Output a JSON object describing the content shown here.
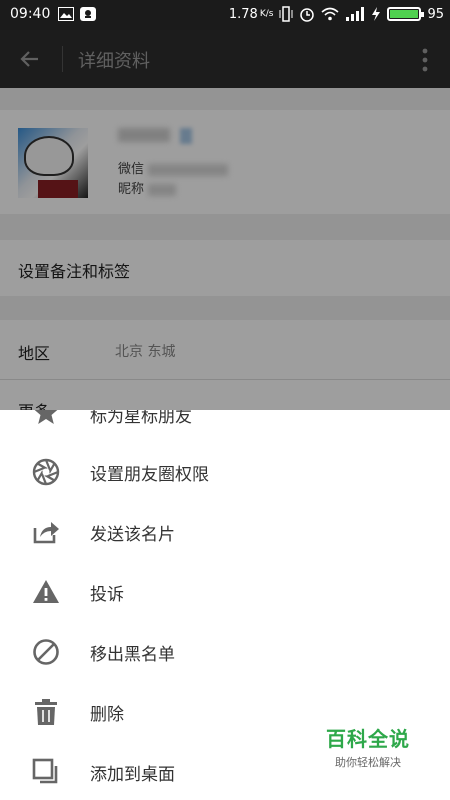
{
  "status_bar": {
    "time": "09:40",
    "network_speed": "1.78",
    "speed_unit": "K/s",
    "battery": "95"
  },
  "title_bar": {
    "title": "详细资料"
  },
  "profile": {
    "wechat_prefix": "微信",
    "nickname_prefix": "昵称"
  },
  "rows": {
    "remark_label": "设置备注和标签",
    "region_label": "地区",
    "region_value": "北京  东城",
    "more_label": "更多"
  },
  "sheet": {
    "items": [
      {
        "label": "标为星标朋友",
        "icon": "star-icon"
      },
      {
        "label": "设置朋友圈权限",
        "icon": "camera-shutter-icon"
      },
      {
        "label": "发送该名片",
        "icon": "share-icon"
      },
      {
        "label": "投诉",
        "icon": "warning-icon"
      },
      {
        "label": "移出黑名单",
        "icon": "block-icon"
      },
      {
        "label": "删除",
        "icon": "trash-icon"
      },
      {
        "label": "添加到桌面",
        "icon": "add-to-desktop-icon"
      }
    ]
  },
  "watermark": {
    "title": "百科全说",
    "subtitle": "助你轻松解决"
  },
  "colors": {
    "status_bar_bg": "#1b1b1b",
    "title_bar_bg": "#2e2e2e",
    "icon_gray": "#666666",
    "watermark_green": "#2ea84a"
  }
}
